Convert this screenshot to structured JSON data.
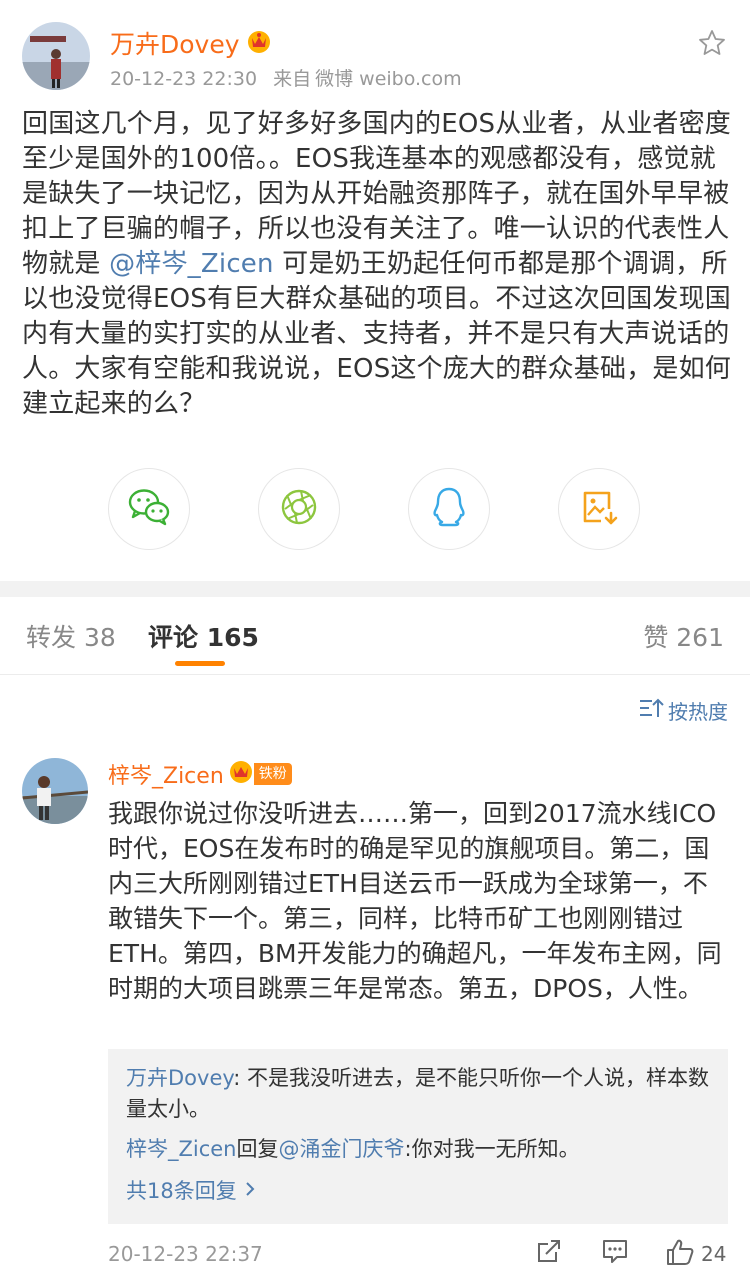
{
  "post": {
    "author": "万卉Dovey",
    "time": "20-12-23 22:30",
    "source_prefix": "来自",
    "source": "微博 weibo.com",
    "text_part1": "回国这几个月，见了好多好多国内的EOS从业者，从业者密度至少是国外的100倍。。EOS我连基本的观感都没有，感觉就是缺失了一块记忆，因为从开始融资那阵子，就在国外早早被扣上了巨骗的帽子，所以也没有关注了。唯一认识的代表性人物就是 ",
    "mention": "@梓岑_Zicen",
    "text_part2": " 可是奶王奶起任何币都是那个调调，所以也没觉得EOS有巨大群众基础的项目。不过这次回国发现国内有大量的实打实的从业者、支持者，并不是只有大声说话的人。大家有空能和我说说，EOS这个庞大的群众基础，是如何建立起来的么？"
  },
  "share_icons": [
    "wechat-icon",
    "moments-icon",
    "qq-icon",
    "save-image-icon"
  ],
  "tabs": {
    "repost": "转发 38",
    "comments": "评论 165",
    "likes": "赞 261"
  },
  "sort_label": "按热度",
  "comment": {
    "author": "梓岑_Zicen",
    "fan_badge": "铁粉",
    "text": "我跟你说过你没听进去……第一，回到2017流水线ICO时代，EOS在发布时的确是罕见的旗舰项目。第二，国内三大所刚刚错过ETH目送云币一跃成为全球第一，不敢错失下一个。第三，同样，比特币矿工也刚刚错过ETH。第四，BM开发能力的确超凡，一年发布主网，同时期的大项目跳票三年是常态。第五，DPOS，人性。",
    "replies": [
      {
        "name": "万卉Dovey",
        "sep": ":",
        "text": " 不是我没听进去，是不能只听你一个人说，样本数量太小。"
      },
      {
        "name": "梓岑_Zicen",
        "mid": "回复",
        "target": "@涌金门庆爷",
        "text": ":你对我一无所知。"
      }
    ],
    "more_replies": "共18条回复",
    "time": "20-12-23 22:37",
    "like_count": "24"
  },
  "colors": {
    "name": "#f86c1a",
    "link": "#507daf",
    "wechat": "#3cb035",
    "moments": "#8dc63f",
    "qq": "#38a9e6",
    "save": "#f4a21c",
    "tab_accent": "#ff8200"
  }
}
